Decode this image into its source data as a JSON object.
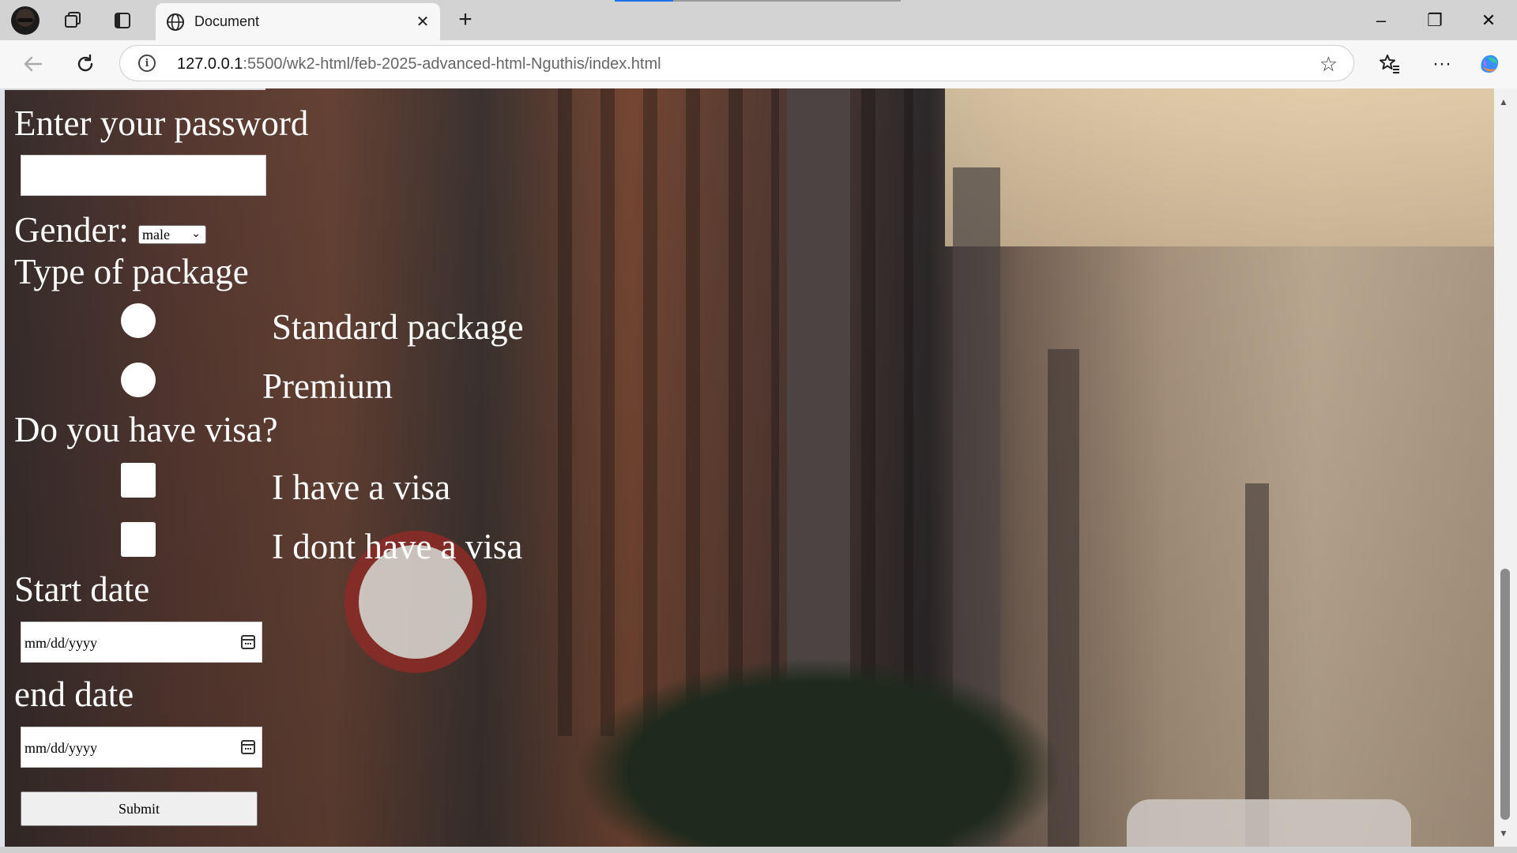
{
  "browser": {
    "tab_title": "Document",
    "url_host": "127.0.0.1",
    "url_path": ":5500/wk2-html/feb-2025-advanced-html-Nguthis/index.html",
    "controls": {
      "minimize": "–",
      "restore": "❐",
      "close": "✕",
      "tab_close": "✕",
      "new_tab": "+"
    },
    "icons": [
      "profile-avatar",
      "workspaces-icon",
      "tab-actions-icon",
      "globe-icon",
      "back-icon",
      "refresh-icon",
      "info-icon",
      "star-icon",
      "favorites-icon",
      "more-icon",
      "copilot-icon"
    ]
  },
  "form": {
    "password_label": "Enter your password",
    "gender_label": "Gender:",
    "gender_value": "male",
    "package_label": "Type of package",
    "package_options": [
      "Standard package",
      "Premium"
    ],
    "visa_label": "Do you have visa?",
    "visa_options": [
      "I have a visa",
      "I dont have a visa"
    ],
    "start_label": "Start date",
    "start_placeholder": "mm/dd/yyyy",
    "end_label": "end date",
    "end_placeholder": "mm/dd/yyyy",
    "submit_label": "Submit"
  },
  "colors": {
    "form_text": "#ffffff",
    "accent_loading": "#1a73e8"
  }
}
